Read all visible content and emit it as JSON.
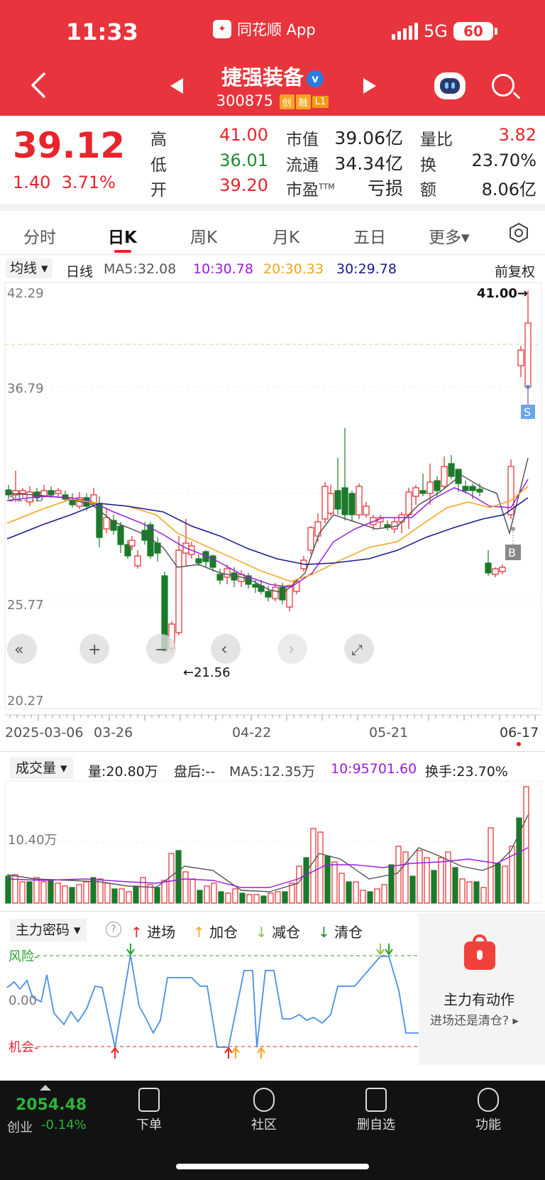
{
  "status_bar": {
    "time": "11:33",
    "app_name": "同花顺 App",
    "network": "5G",
    "battery": "60"
  },
  "header": {
    "stock_name": "捷强装备",
    "verified_icon": "v-badge-icon",
    "code": "300875",
    "tags": [
      "创",
      "融",
      "L1"
    ]
  },
  "quote": {
    "price": "39.12",
    "change": "1.40",
    "change_pct": "3.71%",
    "fields": [
      {
        "label": "高",
        "value": "41.00",
        "color": "#e8242c"
      },
      {
        "label": "低",
        "value": "36.01",
        "color": "#1e8b2e"
      },
      {
        "label": "开",
        "value": "39.20",
        "color": "#e8242c"
      },
      {
        "label": "市值",
        "value": "39.06亿",
        "color": "#222222"
      },
      {
        "label": "流通",
        "value": "34.34亿",
        "color": "#222222"
      },
      {
        "label": "市盈",
        "sup": "TTM",
        "value": "亏损",
        "color": "#222222"
      },
      {
        "label": "量比",
        "value": "3.82",
        "color": "#e8242c"
      },
      {
        "label": "换",
        "value": "23.70%",
        "color": "#222222"
      },
      {
        "label": "额",
        "value": "8.06亿",
        "color": "#222222"
      }
    ]
  },
  "tabs": [
    "分时",
    "日K",
    "周K",
    "月K",
    "五日",
    "更多▾"
  ],
  "active_tab": "日K",
  "ma_row": {
    "selector": "均线",
    "period": "日线",
    "ma5": "MA5:32.08",
    "ma10": "10:30.78",
    "ma20": "20:30.33",
    "ma30": "30:29.78",
    "adjust": "前复权",
    "colors": {
      "ma5": "#555555",
      "ma10": "#9a1be0",
      "ma20": "#f5a31a",
      "ma30": "#1a1a8c"
    }
  },
  "kline": {
    "y_ticks": [
      "42.29",
      "36.79",
      "31.28",
      "25.77",
      "20.27"
    ],
    "high_label": "41.00→",
    "low_label": "←21.56",
    "dates": [
      "2025-03-06",
      "03-26",
      "04-22",
      "05-21",
      "06-17"
    ],
    "signal_s": "S",
    "signal_b": "B",
    "controls": [
      "«",
      "+",
      "−",
      "‹",
      "›",
      "⤢"
    ]
  },
  "volume": {
    "selector": "成交量",
    "vol": "量:20.80万",
    "after": "盘后:--",
    "ma5": "MA5:12.35万",
    "ma10": "10:95701.60",
    "turnover": "换手:23.70%",
    "y_tick": "10.40万"
  },
  "indicator": {
    "selector": "主力密码",
    "legend": [
      {
        "arrow": "↑",
        "label": "进场",
        "color": "#e8242c"
      },
      {
        "arrow": "↑",
        "label": "加仓",
        "color": "#f5a31a"
      },
      {
        "arrow": "↓",
        "label": "减仓",
        "color": "#8bc34a"
      },
      {
        "arrow": "↓",
        "label": "清仓",
        "color": "#1e8b2e"
      }
    ],
    "risk_label": "风险-",
    "zero_label": "0.00",
    "chance_label": "机会-",
    "panel_title": "主力有动作",
    "panel_sub": "进场还是清仓?"
  },
  "footer": {
    "index_value": "2054.48",
    "index_name": "创业",
    "index_change": "-0.14%",
    "items": [
      "下单",
      "社区",
      "删自选",
      "功能"
    ]
  }
}
